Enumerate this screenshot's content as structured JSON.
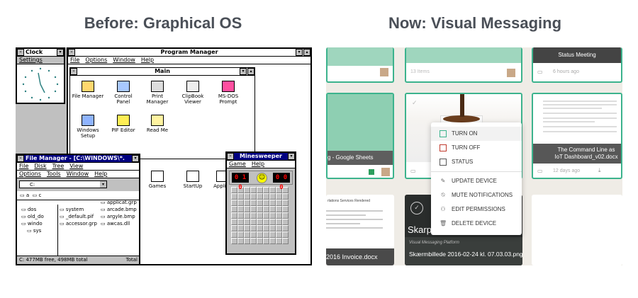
{
  "headings": {
    "before": "Before: Graphical OS",
    "now": "Now: Visual Messaging"
  },
  "clock": {
    "title": "Clock",
    "menu": "Settings"
  },
  "program_manager": {
    "title": "Program Manager",
    "menu": [
      "File",
      "Options",
      "Window",
      "Help"
    ],
    "main_title": "Main",
    "icons": [
      {
        "label": "File Manager",
        "icon": "file-cabinet-icon"
      },
      {
        "label": "Control Panel",
        "icon": "control-panel-icon"
      },
      {
        "label": "Print Manager",
        "icon": "printer-icon"
      },
      {
        "label": "ClipBook Viewer",
        "icon": "clipbook-icon"
      },
      {
        "label": "MS-DOS Prompt",
        "icon": "msdos-icon"
      },
      {
        "label": "Windows Setup",
        "icon": "setup-icon"
      },
      {
        "label": "PIF Editor",
        "icon": "pif-icon"
      },
      {
        "label": "Read Me",
        "icon": "readme-icon"
      }
    ],
    "groups": [
      {
        "label": "Games"
      },
      {
        "label": "StartUp"
      },
      {
        "label": "Applica"
      }
    ]
  },
  "file_manager": {
    "title": "File Manager - [C:\\WINDOWS\\*.",
    "menu1": [
      "File",
      "Disk",
      "Tree",
      "View"
    ],
    "menu2": [
      "Options",
      "Tools",
      "Window",
      "Help"
    ],
    "drive": "C:",
    "drives": [
      "a",
      "c"
    ],
    "tree": [
      "dos",
      "old_do",
      "windo",
      "sys"
    ],
    "files_col1": [
      "system",
      "_default.pif",
      "accessor.grp"
    ],
    "files_col2": [
      "applicat.grp",
      "arcade.bmp",
      "argyle.bmp",
      "awcas.dll"
    ],
    "status": "C: 477MB free,  498MB total",
    "status_right": "Total"
  },
  "minesweeper": {
    "title": "Minesweeper",
    "menu": [
      "Game",
      "Help"
    ],
    "left": "0 1 0",
    "right": "0 0 0"
  },
  "messaging": {
    "card_top_left_footer": "13 Items",
    "status_meeting": "Status Meeting",
    "hours_ago": "6 hours ago",
    "sheets_title": "g - Google Sheets",
    "cmdline_title": "The Command Line as IoT Dashboard_v02.docx",
    "days_ago": "12 days ago",
    "invoice_title": "2016 Invoice.docx",
    "invoice_header": "rlations Services Rendered",
    "skarp_title": "Skarp",
    "screenshot_sub": "Visual Messaging Platform",
    "screenshot_title": "Skærmbillede 2016-02-24 kl. 07.03.03.png",
    "menu_items": [
      {
        "label": "TURN ON",
        "color": "#3cb38d"
      },
      {
        "label": "TURN OFF",
        "color": "#c0392b"
      },
      {
        "label": "STATUS",
        "color": "#555555"
      }
    ],
    "actions": [
      {
        "label": "UPDATE DEVICE",
        "icon": "pencil-icon"
      },
      {
        "label": "MUTE NOTIFICATIONS",
        "icon": "bell-off-icon"
      },
      {
        "label": "EDIT PERMISSIONS",
        "icon": "permissions-icon"
      },
      {
        "label": "DELETE DEVICE",
        "icon": "trash-icon"
      }
    ]
  }
}
